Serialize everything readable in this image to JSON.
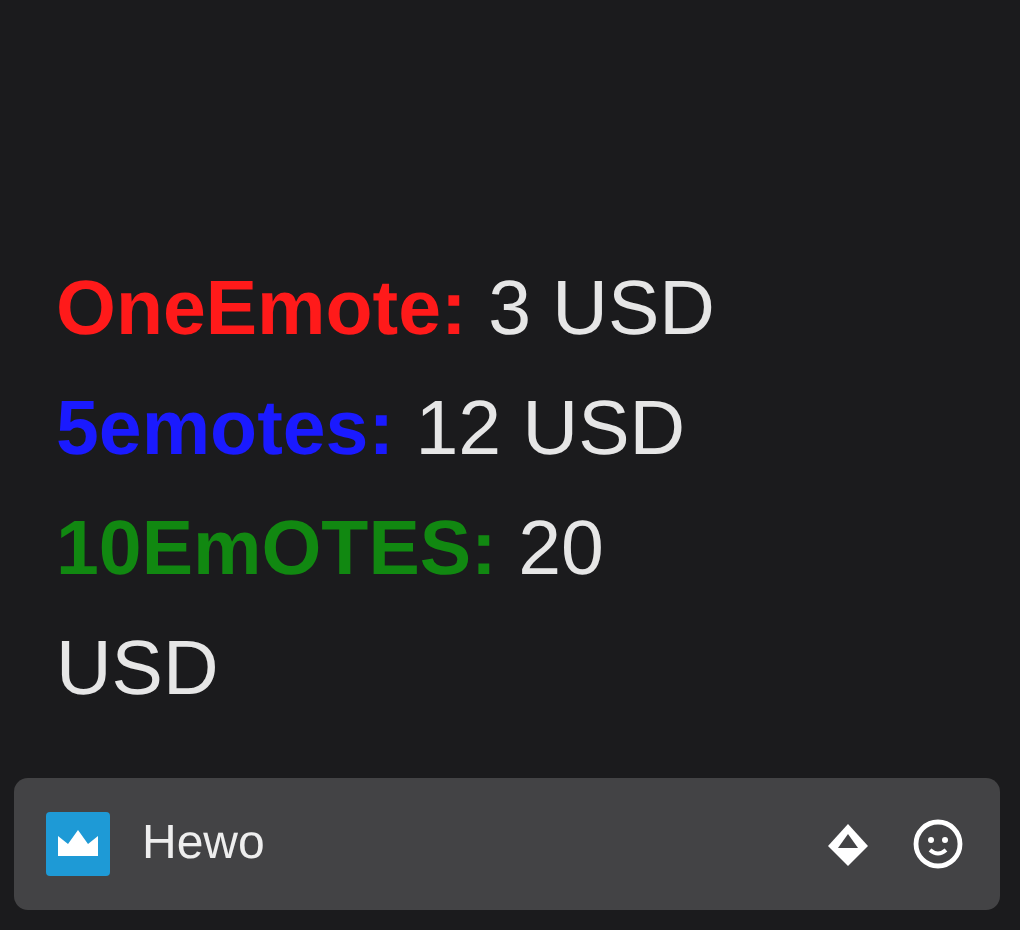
{
  "prices": [
    {
      "label": "OneEmote:",
      "price": "3 USD",
      "color": "#ff1a1a"
    },
    {
      "label": "5emotes:",
      "price": "12 USD",
      "color": "#1a1aff"
    },
    {
      "label": "10EmOTES:",
      "price": "20 USD",
      "color": "#118811"
    }
  ],
  "chat_input": {
    "value": "Hewo"
  }
}
